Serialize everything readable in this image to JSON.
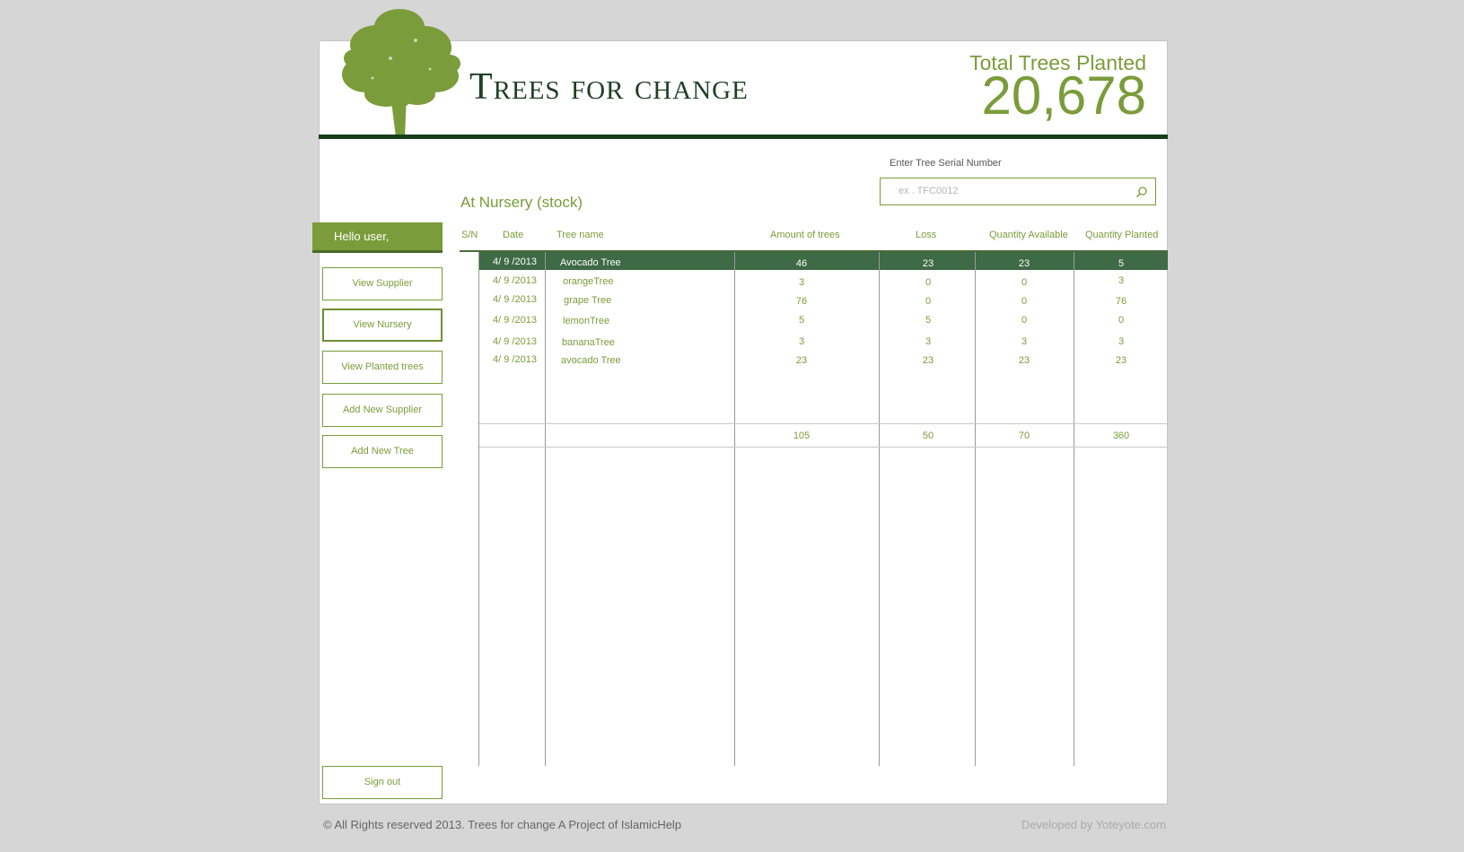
{
  "header": {
    "brand": "Trees for change",
    "total_label": "Total Trees Planted",
    "total_value": "20,678"
  },
  "search": {
    "label": "Enter Tree Serial Number",
    "placeholder": "ex . TFC0012"
  },
  "section_title": "At Nursery (stock)",
  "sidebar": {
    "greeting": "Hello user,",
    "items": [
      {
        "label": "View Supplier",
        "active": false
      },
      {
        "label": "View Nursery",
        "active": true
      },
      {
        "label": "View Planted trees",
        "active": false
      },
      {
        "label": "Add New Supplier",
        "active": false
      },
      {
        "label": "Add New Tree",
        "active": false
      }
    ],
    "signout": "Sign out"
  },
  "table": {
    "columns": [
      "S/N",
      "Date",
      "Tree name",
      "Amount of trees",
      "Loss",
      "Quantity Available",
      "Quantity Planted"
    ],
    "rows": [
      {
        "date": "4/ 9 /2013",
        "name": "Avocado Tree",
        "amount": "46",
        "loss": "23",
        "available": "23",
        "planted": "5",
        "selected": true
      },
      {
        "date": "4/ 9 /2013",
        "name": "orangeTree",
        "amount": "3",
        "loss": "0",
        "available": "0",
        "planted": "3",
        "selected": false
      },
      {
        "date": "4/ 9 /2013",
        "name": "grape Tree",
        "amount": "76",
        "loss": "0",
        "available": "0",
        "planted": "76",
        "selected": false
      },
      {
        "date": "4/ 9 /2013",
        "name": "lemonTree",
        "amount": "5",
        "loss": "5",
        "available": "0",
        "planted": "0",
        "selected": false
      },
      {
        "date": "4/ 9 /2013",
        "name": "bananaTree",
        "amount": "3",
        "loss": "3",
        "available": "3",
        "planted": "3",
        "selected": false
      },
      {
        "date": "4/ 9 /2013",
        "name": "avocado Tree",
        "amount": "23",
        "loss": "23",
        "available": "23",
        "planted": "23",
        "selected": false
      }
    ],
    "totals": {
      "amount": "105",
      "loss": "50",
      "available": "70",
      "planted": "360"
    }
  },
  "footer": {
    "copyright": "© All Rights reserved 2013. Trees for change A Project of IslamicHelp",
    "developer": "Developed by Yoteyote.com"
  },
  "colors": {
    "accent": "#7a9c3a",
    "dark_green": "#173d1c",
    "selected_row": "#3e6a45",
    "background": "#d6d6d6"
  }
}
